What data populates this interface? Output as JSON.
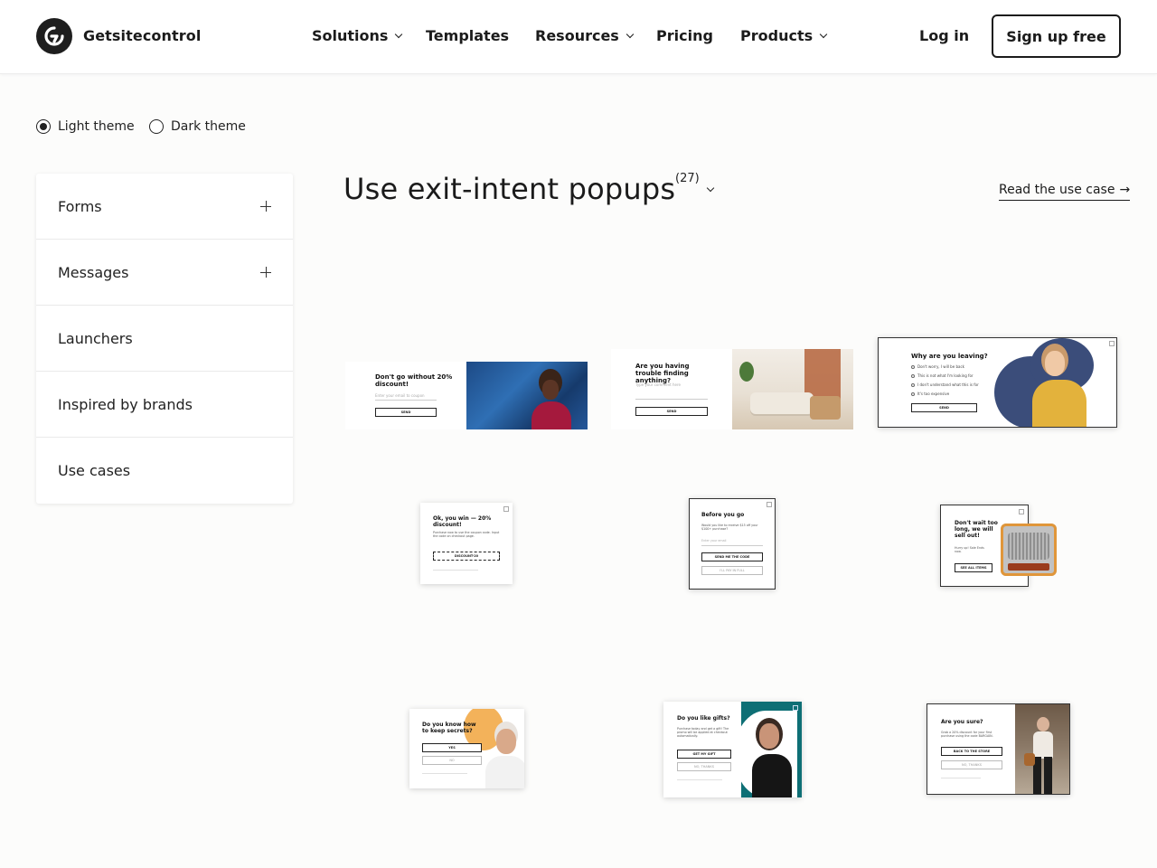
{
  "header": {
    "brand": "Getsitecontrol",
    "nav": [
      {
        "label": "Solutions",
        "has_dropdown": true
      },
      {
        "label": "Templates",
        "has_dropdown": false
      },
      {
        "label": "Resources",
        "has_dropdown": true
      },
      {
        "label": "Pricing",
        "has_dropdown": false
      },
      {
        "label": "Products",
        "has_dropdown": true
      }
    ],
    "login": "Log in",
    "signup": "Sign up free"
  },
  "theme": {
    "options": [
      "Light theme",
      "Dark theme"
    ],
    "selected": "Light theme"
  },
  "sidebar": {
    "items": [
      {
        "label": "Forms",
        "expandable": true
      },
      {
        "label": "Messages",
        "expandable": true
      },
      {
        "label": "Launchers",
        "expandable": false
      },
      {
        "label": "Inspired by brands",
        "expandable": false
      },
      {
        "label": "Use cases",
        "expandable": false
      }
    ]
  },
  "main": {
    "title": "Use exit-intent popups",
    "count": "(27)",
    "use_case_link": "Read the use case",
    "arrow": "→"
  },
  "popups": {
    "p1": {
      "title": "Don't go without 20% discount!",
      "input": "Enter your email to coupon",
      "button": "SEND"
    },
    "p2": {
      "title": "Are you having trouble finding anything?",
      "input": "Type your comment here",
      "button": "SEND"
    },
    "p3": {
      "title": "Why are you leaving?",
      "options": [
        "Don't worry, I will be back",
        "This is not what I'm looking for",
        "I don't understand what this is for",
        "It's too expensive"
      ],
      "button": "SEND"
    },
    "p4": {
      "title": "Ok, you win — 20% discount!",
      "text": "Purchase now to use the coupon code. Input the code on checkout page.",
      "code": "DISCOUNT-20"
    },
    "p5": {
      "title": "Before you go",
      "text": "Would you like to receive $15 off your $100+ purchase?",
      "input": "Enter your email",
      "button": "SEND ME THE CODE",
      "secondary": "I'LL PAY IN FULL"
    },
    "p6": {
      "title": "Don't wait too long, we will sell out!",
      "text": "Hurry up! Sale Ends now.",
      "button": "SEE ALL ITEMS"
    },
    "p7": {
      "title": "Do you know how to keep secrets?",
      "button": "YES",
      "secondary": "NO"
    },
    "p8": {
      "title": "Do you like gifts?",
      "text": "Purchase today and get a gift! The promo will be applied at checkout automatically.",
      "button": "GET MY GIFT",
      "secondary": "NO, THANKS"
    },
    "p9": {
      "title": "Are you sure?",
      "text": "Grab a 20% discount for your first purchase using the code BARGAIN.",
      "button": "BACK TO THE STORE",
      "secondary": "NO, THANKS"
    }
  },
  "colors": {
    "accent": "#1b1b1b",
    "background": "#fcfcfb",
    "navy": "#3b4d7a",
    "yellow": "#e3b23c",
    "orange": "#f3b25a",
    "teal": "#0e6f75"
  }
}
